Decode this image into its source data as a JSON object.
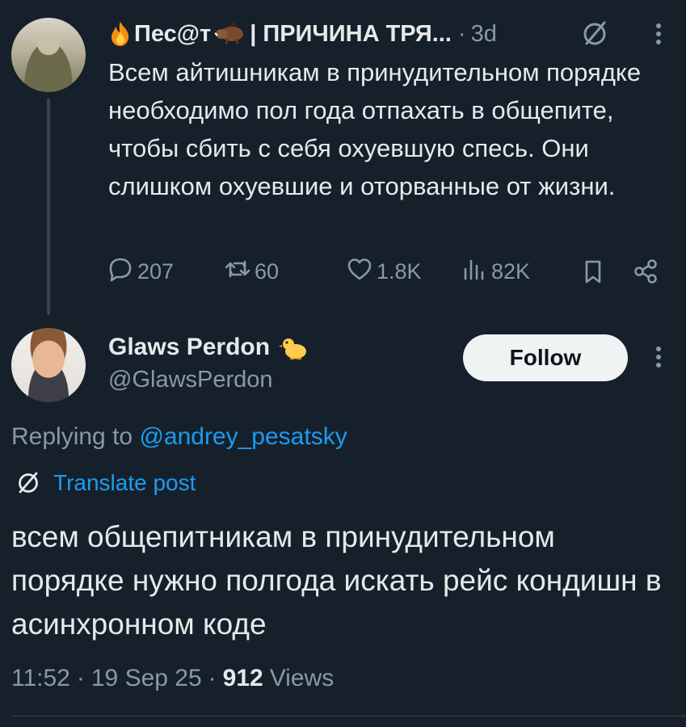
{
  "parent": {
    "author_name": "Пес@т",
    "author_suffix": "| ПРИЧИНА ТРЯ...",
    "separator": "·",
    "time": "3d",
    "text": "Всем айтишникам в принудительном порядке необходимо пол года отпахать в общепите, чтобы сбить с себя охуевшую спесь. Они слишком охуевшие и оторванные от жизни.",
    "stats": {
      "replies": "207",
      "reposts": "60",
      "likes": "1.8K",
      "views": "82K"
    },
    "icons": [
      "fire-icon",
      "boar-icon",
      "no-translate-icon",
      "more-icon",
      "reply-icon",
      "repost-icon",
      "like-icon",
      "views-icon",
      "bookmark-icon",
      "share-icon"
    ]
  },
  "reply": {
    "author_name": "Glaws Perdon",
    "handle": "@GlawsPerdon",
    "follow_label": "Follow",
    "replying_prefix": "Replying to ",
    "replying_mention": "@andrey_pesatsky",
    "translate_label": "Translate post",
    "text": "всем общепитникам в принудительном порядке нужно полгода искать рейс кондишн в асинхронном коде",
    "time": "11:52",
    "separator": "·",
    "date": "19 Sep 25",
    "views_count": "912",
    "views_label": "Views",
    "icons": [
      "duckling-icon",
      "more-icon",
      "translate-icon"
    ]
  },
  "colors": {
    "background": "#15202b",
    "text_primary": "#e7e9ea",
    "text_secondary": "#8b98a5",
    "accent": "#1d9bf0",
    "divider": "#38444d",
    "follow_bg": "#eff3f4"
  }
}
